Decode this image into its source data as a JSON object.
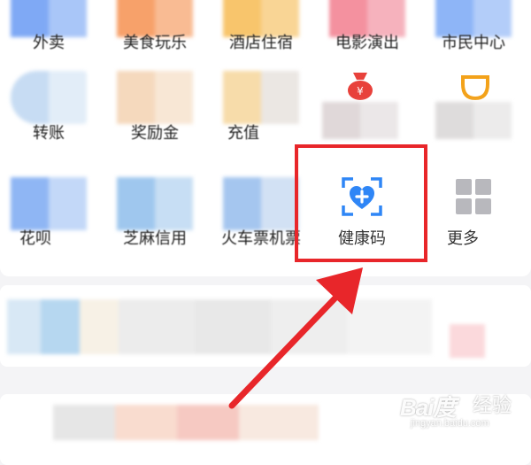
{
  "grid": {
    "row1": [
      "外卖",
      "美食玩乐",
      "酒店住宿",
      "电影演出",
      "市民中心"
    ],
    "row2": [
      "转账",
      "奖励金",
      "充值"
    ],
    "row3": [
      "花呗",
      "芝麻信用",
      "火车票机票",
      "健康码",
      "更多"
    ]
  },
  "highlight_color": "#e8262a",
  "health_icon_color": "#2f86f6",
  "icons": {
    "health_code": "health-code-heart-scan-icon",
    "more": "more-grid-icon",
    "red_envelope": "money-bag-icon",
    "cup": "cup-icon"
  },
  "watermark": {
    "logo": "Bai度",
    "cn": "经验",
    "url": "jingyan.baidu.com"
  }
}
